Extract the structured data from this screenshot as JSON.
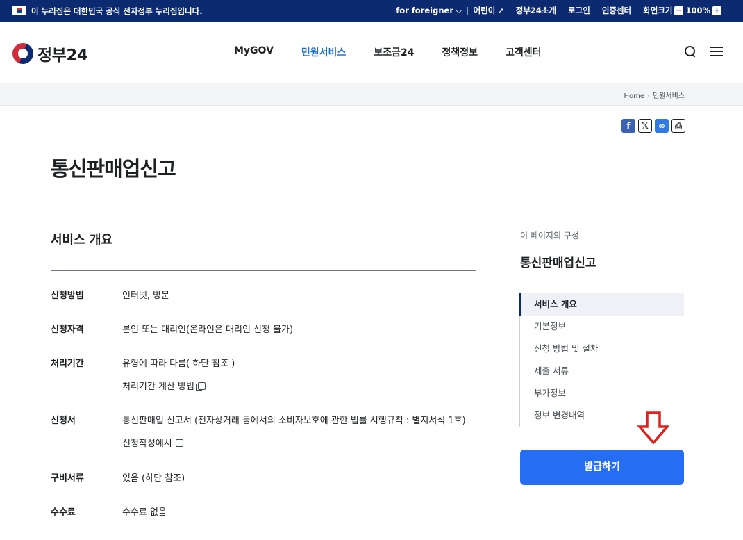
{
  "topbar": {
    "notice": "이 누리집은 대한민국 공식 전자정부 누리집입니다.",
    "foreigner": "for foreigner",
    "kids": "어린이",
    "intro": "정부24소개",
    "login": "로그인",
    "cert": "인증센터",
    "zoom_label": "화면크기",
    "zoom_value": "100%"
  },
  "header": {
    "logo_text": "정부24",
    "nav": [
      "MyGOV",
      "민원서비스",
      "보조금24",
      "정책정보",
      "고객센터"
    ],
    "active_nav": "민원서비스"
  },
  "breadcrumb": [
    "Home",
    "민원서비스"
  ],
  "page": {
    "title": "통신판매업신고",
    "section_title": "서비스 개요"
  },
  "info": [
    {
      "label": "신청방법",
      "value": "인터넷, 방문"
    },
    {
      "label": "신청자격",
      "value": "본인 또는 대리인(온라인은 대리인 신청 불가)"
    },
    {
      "label": "처리기간",
      "value": "유형에 따라 다름( 하단 참조 )",
      "link": "처리기간 계산 방법"
    },
    {
      "label": "신청서",
      "value": "통신판매업 신고서 (전자상거래 등에서의 소비자보호에 관한 법률 시행규칙 : 별지서식 1호)",
      "link": "신청작성예시"
    },
    {
      "label": "구비서류",
      "value": "있음 (하단 참조)"
    },
    {
      "label": "수수료",
      "value": "수수료 없음"
    }
  ],
  "toc": {
    "label": "이 페이지의 구성",
    "title": "통신판매업신고",
    "items": [
      "서비스 개요",
      "기본정보",
      "신청 방법 및 절차",
      "제출 서류",
      "부가정보",
      "정보 변경내역"
    ]
  },
  "issue_button": "발급하기",
  "colors": {
    "brand_navy": "#0b2a6f",
    "accent_blue": "#256ef4",
    "arrow_red": "#e0201b"
  }
}
